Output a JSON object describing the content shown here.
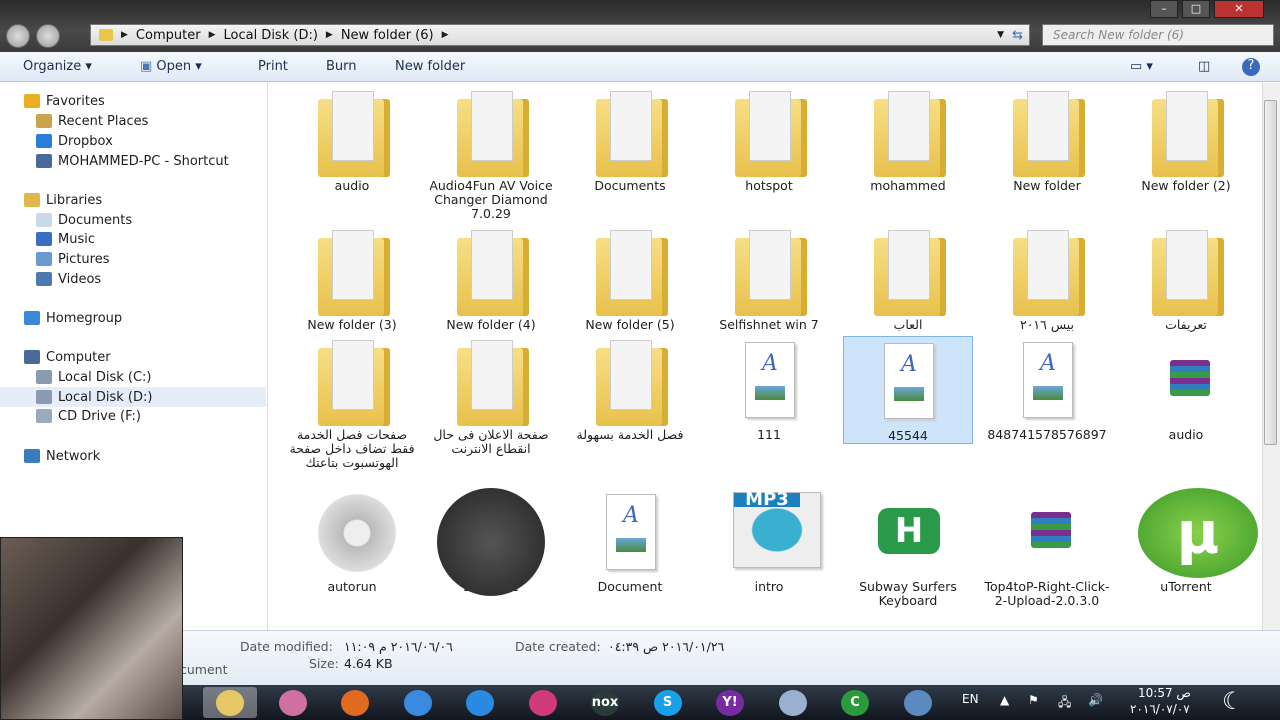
{
  "window": {
    "controls": [
      "minimize",
      "maximize",
      "close"
    ]
  },
  "address": {
    "crumbs": [
      "Computer",
      "Local Disk (D:)",
      "New folder (6)"
    ],
    "search_placeholder": "Search New folder (6)"
  },
  "toolbar": {
    "organize": "Organize ▾",
    "open": "Open ▾",
    "print": "Print",
    "burn": "Burn",
    "new_folder": "New folder"
  },
  "sidebar": [
    {
      "label": "Favorites",
      "icon": "star-icon",
      "color": "#e8b020",
      "header": true
    },
    {
      "label": "Recent Places",
      "icon": "recent-places-icon",
      "color": "#c9a44a"
    },
    {
      "label": "Dropbox",
      "icon": "dropbox-icon",
      "color": "#2a7ed8"
    },
    {
      "label": "MOHAMMED-PC - Shortcut",
      "icon": "computer-icon",
      "color": "#4a6a9a"
    },
    {
      "label": "Libraries",
      "icon": "library-icon",
      "color": "#e0b84a",
      "header": true
    },
    {
      "label": "Documents",
      "icon": "documents-icon",
      "color": "#c9d8ea"
    },
    {
      "label": "Music",
      "icon": "music-icon",
      "color": "#3a6ec0"
    },
    {
      "label": "Pictures",
      "icon": "pictures-icon",
      "color": "#6a9ad0"
    },
    {
      "label": "Videos",
      "icon": "videos-icon",
      "color": "#4a7ab0"
    },
    {
      "label": "Homegroup",
      "icon": "homegroup-icon",
      "color": "#3a8ad8",
      "header": true
    },
    {
      "label": "Computer",
      "icon": "computer-icon",
      "color": "#4a6a9a",
      "header": true
    },
    {
      "label": "Local Disk (C:)",
      "icon": "drive-icon",
      "color": "#8a9ab0"
    },
    {
      "label": "Local Disk (D:)",
      "icon": "drive-icon",
      "color": "#8a9ab0",
      "selected": true
    },
    {
      "label": "CD Drive (F:)",
      "icon": "cd-drive-icon",
      "color": "#9aaabb"
    },
    {
      "label": "Network",
      "icon": "network-icon",
      "color": "#3a7ac0",
      "header": true
    }
  ],
  "items": [
    {
      "name": "audio",
      "type": "folder"
    },
    {
      "name": "Audio4Fun AV Voice Changer Diamond 7.0.29",
      "type": "folder"
    },
    {
      "name": "Documents",
      "type": "folder"
    },
    {
      "name": "hotspot",
      "type": "folder"
    },
    {
      "name": "mohammed",
      "type": "folder"
    },
    {
      "name": "New folder",
      "type": "folder"
    },
    {
      "name": "New folder (2)",
      "type": "folder"
    },
    {
      "name": "New folder (3)",
      "type": "folder"
    },
    {
      "name": "New folder (4)",
      "type": "folder"
    },
    {
      "name": "New folder (5)",
      "type": "folder"
    },
    {
      "name": "Selfishnet win 7",
      "type": "folder"
    },
    {
      "name": "العاب",
      "type": "folder"
    },
    {
      "name": "بيس ٢٠١٦",
      "type": "folder"
    },
    {
      "name": "تعريفات",
      "type": "folder"
    },
    {
      "name": "صفحات فصل الخدمة فقط تضاف داخل صفحة الهوتسبوت بتاعتك",
      "type": "folder"
    },
    {
      "name": "صفحة الاعلان فى حال انقطاع الانترنت",
      "type": "folder"
    },
    {
      "name": "فصل الخدمة بسهولة",
      "type": "folder"
    },
    {
      "name": "111",
      "type": "document"
    },
    {
      "name": "45544",
      "type": "document",
      "selected": true
    },
    {
      "name": "848741578576897",
      "type": "document"
    },
    {
      "name": "audio",
      "type": "archive"
    },
    {
      "name": "autorun",
      "type": "settings"
    },
    {
      "name": "DLLSuite",
      "type": "dllsuite"
    },
    {
      "name": "Document",
      "type": "document"
    },
    {
      "name": "intro",
      "type": "mp3",
      "badge": "MP3"
    },
    {
      "name": "Subway Surfers Keyboard",
      "type": "app",
      "badge": "H"
    },
    {
      "name": "Top4toP-Right-Click-2-Upload-2.0.3.0",
      "type": "archive"
    },
    {
      "name": "uTorrent",
      "type": "utorrent",
      "badge": "µ"
    }
  ],
  "details": {
    "type_fragment": "cument",
    "modified_label": "Date modified:",
    "modified": "٢٠١٦/٠٦/٠٦ م ١١:٠٩",
    "created_label": "Date created:",
    "created": "٢٠١٦/٠١/٢٦ ص ٠٤:٣٩",
    "size_label": "Size:",
    "size": "4.64 KB"
  },
  "taskbar": {
    "apps": [
      {
        "name": "explorer",
        "color": "#e8c866"
      },
      {
        "name": "photo",
        "color": "#d070a0"
      },
      {
        "name": "firefox",
        "color": "#e06a20"
      },
      {
        "name": "chrome",
        "color": "#3a8ae0"
      },
      {
        "name": "internet-explorer",
        "color": "#2a8ae0"
      },
      {
        "name": "app-s",
        "color": "#d03a7a"
      },
      {
        "name": "nox",
        "color": "#2a3a3a",
        "label": "nox"
      },
      {
        "name": "skype",
        "color": "#1aa0e8",
        "label": "S"
      },
      {
        "name": "yahoo-messenger",
        "color": "#7a2aa0",
        "label": "Y!"
      },
      {
        "name": "document-viewer",
        "color": "#9ab0d0"
      },
      {
        "name": "camtasia",
        "color": "#2a9a3a",
        "label": "C"
      },
      {
        "name": "screen",
        "color": "#5a8ac0"
      }
    ],
    "language": "EN",
    "time": "10:57 ص",
    "date": "٢٠١٦/٠٧/٠٧"
  }
}
